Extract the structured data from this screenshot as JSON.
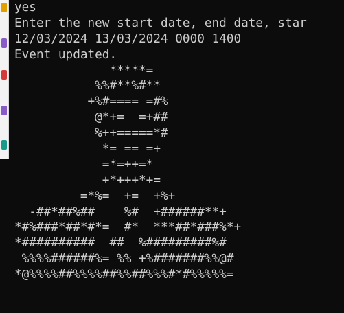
{
  "side_icons": [
    {
      "name": "chat-icon",
      "color": "#e0a000"
    },
    {
      "name": "pencil-icon",
      "color": "#8a5cc8"
    },
    {
      "name": "pdf-icon",
      "color": "#d33b3b"
    },
    {
      "name": "stamp-icon",
      "color": "#8a5cc8"
    },
    {
      "name": "pen-icon",
      "color": "#1a9a8a"
    },
    {
      "name": "eraser-icon",
      "color": "#a04cc0"
    }
  ],
  "terminal": {
    "lines": [
      "yes",
      "Enter the new start date, end date, star",
      "12/03/2024 13/03/2024 0000 1400",
      "Event updated.",
      "             *****=",
      "           %%#**%#**",
      "          +%#==== =#%",
      "           @*+=  =+##",
      "           %++=====*#",
      "            *= == =+",
      "            =*=++=*",
      "            +*+++*+=",
      "         =*%=  +=  +%+",
      "  -##*##%##    %#  +######**+",
      "*#%###*##*#*=  #*  ***##*###%*+",
      "*##########  ##  %#########%#",
      " %%%%######%= %% +%#######%%@#",
      "*@%%%%##%%%%##%%##%%%#*#%%%%%="
    ]
  }
}
